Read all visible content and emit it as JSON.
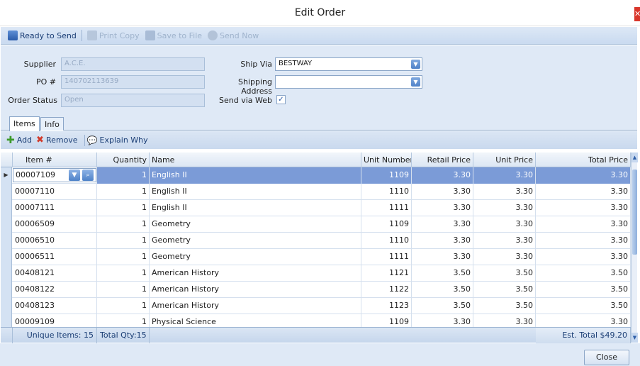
{
  "window": {
    "title": "Edit Order"
  },
  "toolbar": {
    "ready_to_send": "Ready to Send",
    "print_copy": "Print Copy",
    "save_to_file": "Save to File",
    "send_now": "Send Now"
  },
  "form": {
    "supplier_label": "Supplier",
    "supplier_value": "A.C.E.",
    "po_label": "PO #",
    "po_value": "140702113639",
    "order_status_label": "Order Status",
    "order_status_value": "Open",
    "ship_via_label": "Ship Via",
    "ship_via_value": "BESTWAY",
    "shipping_address_label": "Shipping Address",
    "shipping_address_value": "",
    "send_via_web_label": "Send via Web",
    "send_via_web_checked": true
  },
  "tabs": [
    {
      "label": "Items",
      "active": true
    },
    {
      "label": "Info",
      "active": false
    }
  ],
  "grid_toolbar": {
    "add": "Add",
    "remove": "Remove",
    "explain_why": "Explain Why"
  },
  "grid": {
    "columns": [
      "Item #",
      "Quantity",
      "Name",
      "Unit Number",
      "Retail Price",
      "Unit Price",
      "Total Price"
    ],
    "rows": [
      {
        "item": "00007109",
        "qty": "1",
        "name": "English II",
        "unit_number": "1109",
        "retail": "3.30",
        "unit_price": "3.30",
        "total": "3.30"
      },
      {
        "item": "00007110",
        "qty": "1",
        "name": "English II",
        "unit_number": "1110",
        "retail": "3.30",
        "unit_price": "3.30",
        "total": "3.30"
      },
      {
        "item": "00007111",
        "qty": "1",
        "name": "English II",
        "unit_number": "1111",
        "retail": "3.30",
        "unit_price": "3.30",
        "total": "3.30"
      },
      {
        "item": "00006509",
        "qty": "1",
        "name": "Geometry",
        "unit_number": "1109",
        "retail": "3.30",
        "unit_price": "3.30",
        "total": "3.30"
      },
      {
        "item": "00006510",
        "qty": "1",
        "name": "Geometry",
        "unit_number": "1110",
        "retail": "3.30",
        "unit_price": "3.30",
        "total": "3.30"
      },
      {
        "item": "00006511",
        "qty": "1",
        "name": "Geometry",
        "unit_number": "1111",
        "retail": "3.30",
        "unit_price": "3.30",
        "total": "3.30"
      },
      {
        "item": "00408121",
        "qty": "1",
        "name": "American History",
        "unit_number": "1121",
        "retail": "3.50",
        "unit_price": "3.50",
        "total": "3.50"
      },
      {
        "item": "00408122",
        "qty": "1",
        "name": "American History",
        "unit_number": "1122",
        "retail": "3.50",
        "unit_price": "3.50",
        "total": "3.50"
      },
      {
        "item": "00408123",
        "qty": "1",
        "name": "American History",
        "unit_number": "1123",
        "retail": "3.50",
        "unit_price": "3.50",
        "total": "3.50"
      },
      {
        "item": "00009109",
        "qty": "1",
        "name": "Physical Science",
        "unit_number": "1109",
        "retail": "3.30",
        "unit_price": "3.30",
        "total": "3.30"
      }
    ]
  },
  "footer": {
    "unique_items": "Unique Items: 15",
    "total_qty": "Total Qty:15",
    "est_total": "Est. Total $49.20"
  },
  "buttons": {
    "close": "Close"
  },
  "colors": {
    "accent": "#7b9bd7",
    "toolbar_bg": "#dde8f6",
    "panel_bg": "#dfe9f6",
    "title_close": "#d9362b"
  }
}
